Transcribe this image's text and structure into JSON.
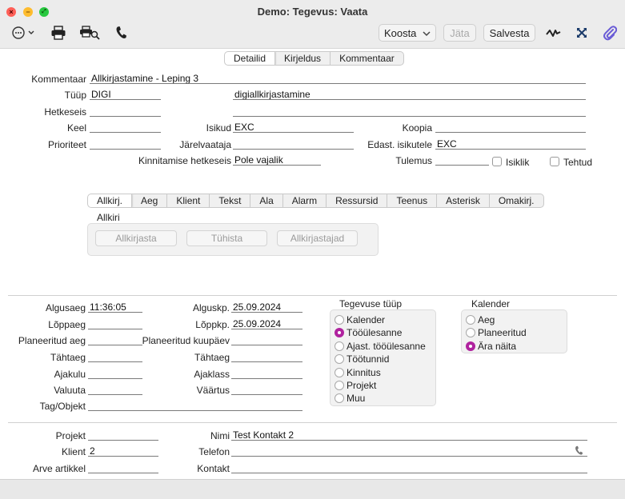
{
  "window": {
    "title": "Demo: Tegevus: Vaata"
  },
  "toolbar": {
    "koosta_label": "Koosta",
    "jata_label": "Jäta",
    "salvesta_label": "Salvesta"
  },
  "top_tabs": [
    "Detailid",
    "Kirjeldus",
    "Kommentaar"
  ],
  "header": {
    "kommentaar_label": "Kommentaar",
    "kommentaar_value": "Allkirjastamine - Leping 3",
    "tuup_label": "Tüüp",
    "tuup_value": "DIGI",
    "tuup_desc": "digiallkirjastamine",
    "hetkeseis_label": "Hetkeseis",
    "keel_label": "Keel",
    "isikud_label": "Isikud",
    "isikud_value": "EXC",
    "koopia_label": "Koopia",
    "prioriteet_label": "Prioriteet",
    "jarelvaataja_label": "Järelvaataja",
    "edast_label": "Edast. isikutele",
    "edast_value": "EXC",
    "kinnitamise_label": "Kinnitamise hetkeseis",
    "kinnitamise_value": "Pole vajalik",
    "tulemus_label": "Tulemus",
    "isiklik_label": "Isiklik",
    "tehtud_label": "Tehtud"
  },
  "inner_tabs": [
    "Allkirj.",
    "Aeg",
    "Klient",
    "Tekst",
    "Ala",
    "Alarm",
    "Ressursid",
    "Teenus",
    "Asterisk",
    "Omakirj."
  ],
  "allkiri": {
    "title": "Allkiri",
    "btn_allkirjasta": "Allkirjasta",
    "btn_tuhista": "Tühista",
    "btn_allkirjastajad": "Allkirjastajad"
  },
  "time": {
    "algusaeg_label": "Algusaeg",
    "algusaeg_value": "11:36:05",
    "loppaeg_label": "Lõppaeg",
    "planeeritud_aeg_label": "Planeeritud aeg",
    "tahtaeg_label": "Tähtaeg",
    "ajakulu_label": "Ajakulu",
    "valuuta_label": "Valuuta",
    "tagobjekt_label": "Tag/Objekt",
    "alguskp_label": "Alguskp.",
    "alguskp_value": "25.09.2024",
    "loppkp_label": "Lõppkp.",
    "loppkp_value": "25.09.2024",
    "planeeritud_kp_label": "Planeeritud kuupäev",
    "tahtaeg2_label": "Tähtaeg",
    "ajaklass_label": "Ajaklass",
    "vaartus_label": "Väärtus"
  },
  "tegevuse_tuup": {
    "title": "Tegevuse tüüp",
    "options": [
      "Kalender",
      "Tööülesanne",
      "Ajast. tööülesanne",
      "Töötunnid",
      "Kinnitus",
      "Projekt",
      "Muu"
    ],
    "selected": "Tööülesanne"
  },
  "kalender": {
    "title": "Kalender",
    "options": [
      "Aeg",
      "Planeeritud",
      "Ära näita"
    ],
    "selected": "Ära näita"
  },
  "bottom": {
    "projekt_label": "Projekt",
    "klient_label": "Klient",
    "klient_value": "2",
    "arve_label": "Arve artikkel",
    "nimi_label": "Nimi",
    "nimi_value": "Test Kontakt 2",
    "telefon_label": "Telefon",
    "kontakt_label": "Kontakt"
  },
  "colors": {
    "accent": "#b0239f",
    "close": "#ff5f57",
    "minimize": "#febc2e",
    "zoom": "#28c840",
    "attach": "#6a5cd6"
  }
}
